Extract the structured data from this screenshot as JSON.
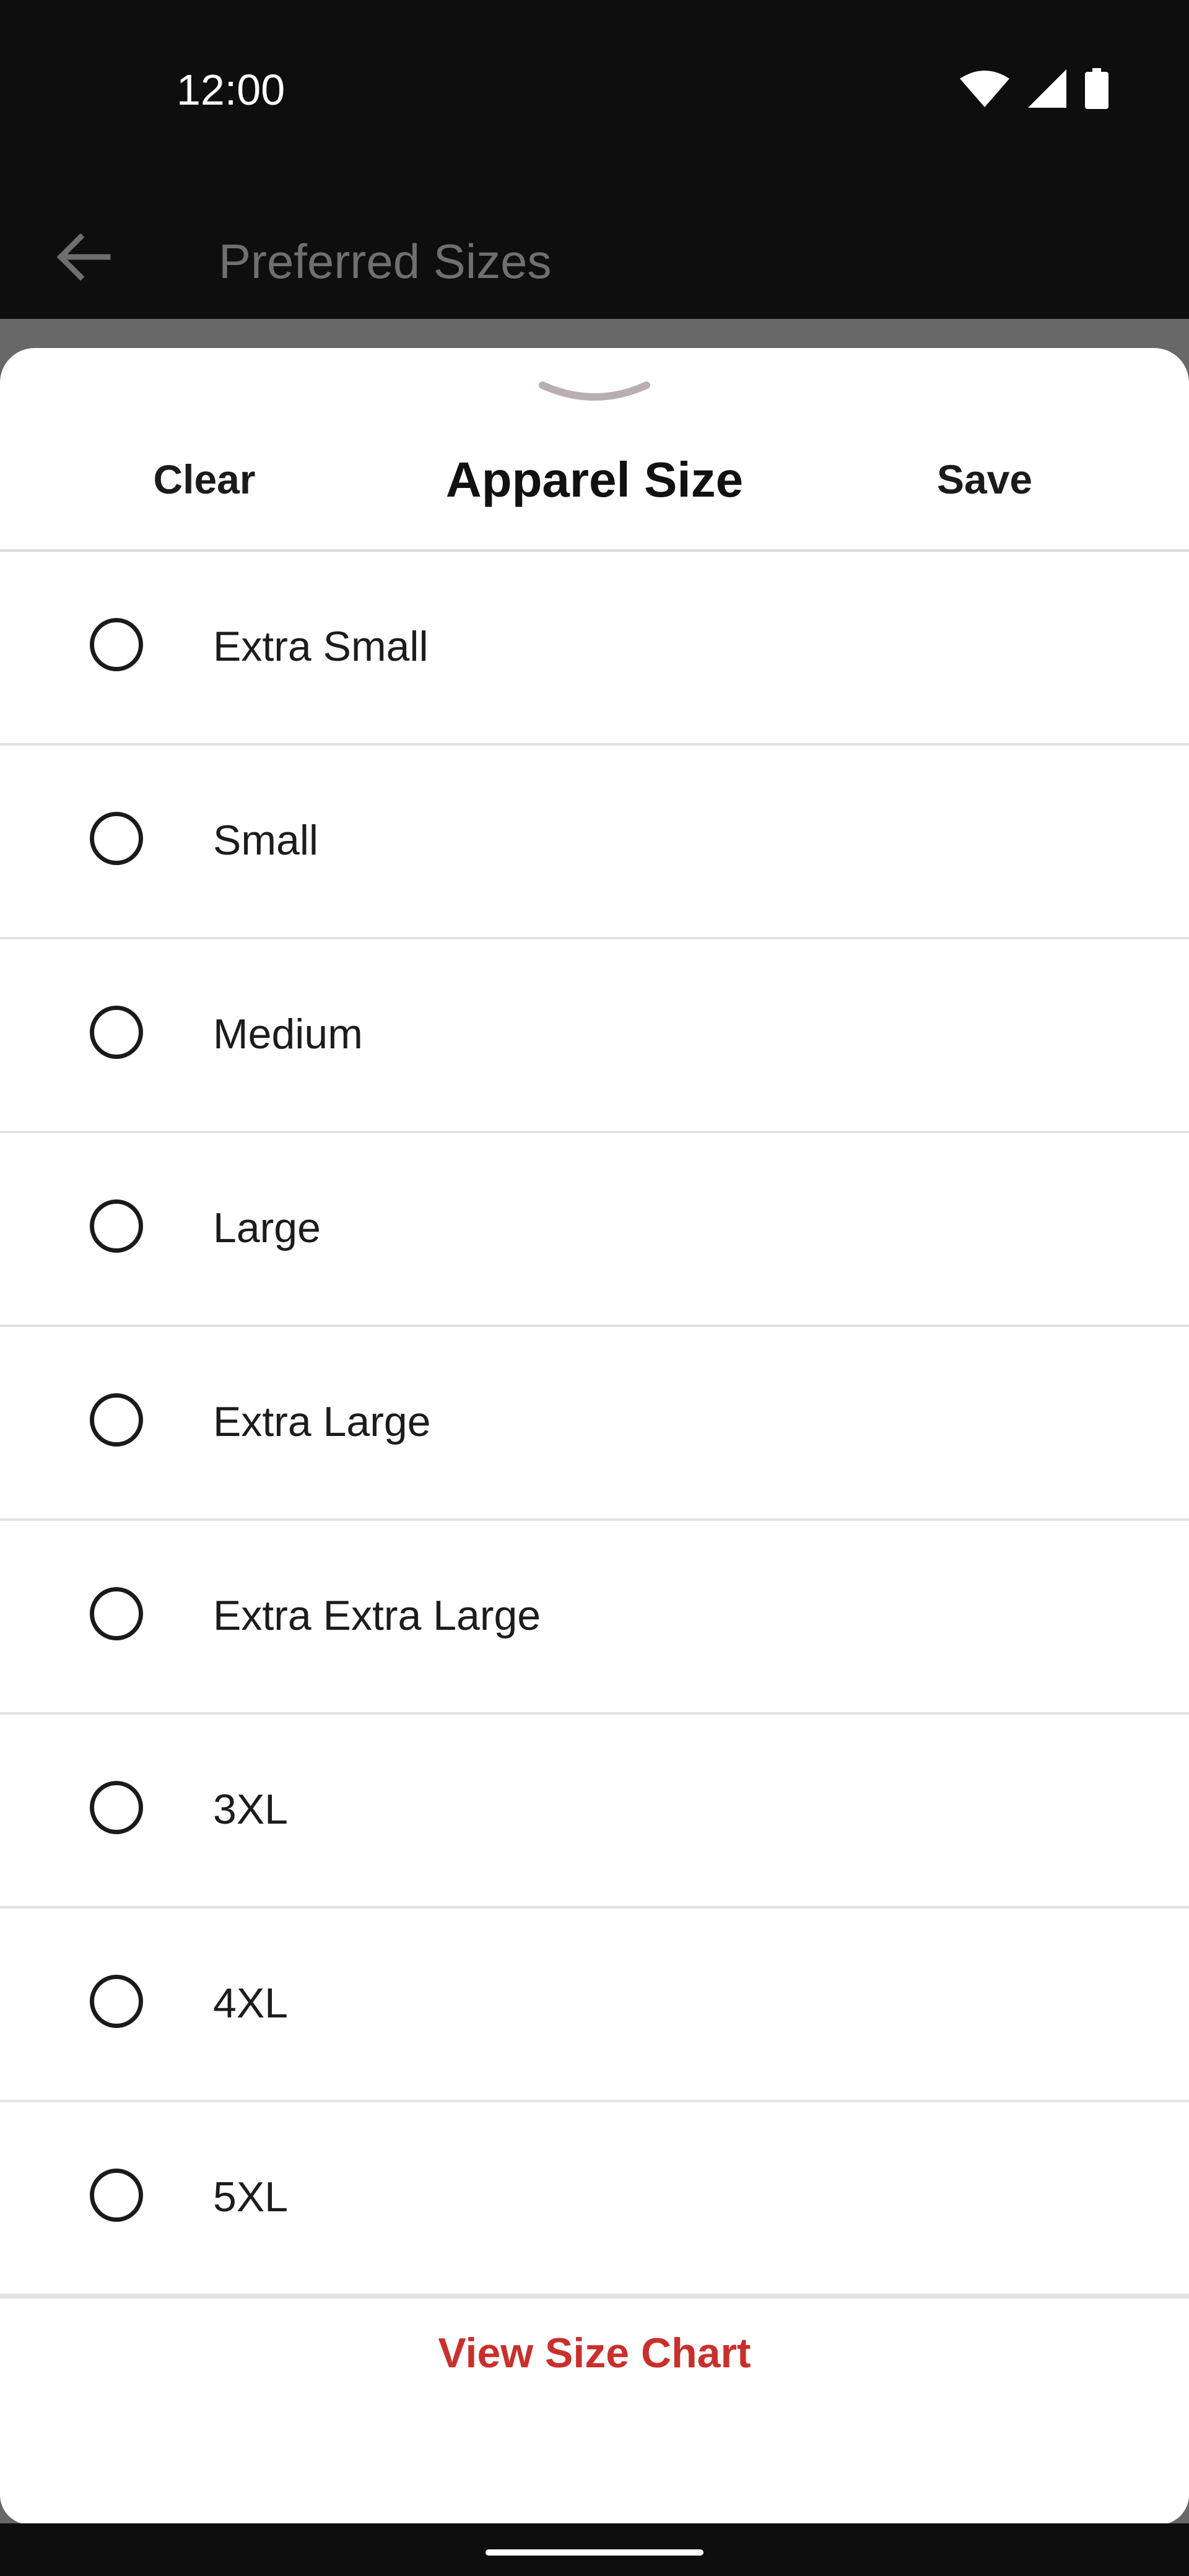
{
  "status_bar": {
    "time": "12:00",
    "icons": [
      "wifi-icon",
      "signal-icon",
      "battery-icon"
    ]
  },
  "toolbar": {
    "title": "Preferred Sizes",
    "back_icon": "back-arrow-icon"
  },
  "sheet": {
    "title": "Apparel Size",
    "clear_label": "Clear",
    "save_label": "Save",
    "options": [
      {
        "label": "Extra Small",
        "selected": false
      },
      {
        "label": "Small",
        "selected": false
      },
      {
        "label": "Medium",
        "selected": false
      },
      {
        "label": "Large",
        "selected": false
      },
      {
        "label": "Extra Large",
        "selected": false
      },
      {
        "label": "Extra Extra Large",
        "selected": false
      },
      {
        "label": "3XL",
        "selected": false
      },
      {
        "label": "4XL",
        "selected": false
      },
      {
        "label": "5XL",
        "selected": false
      }
    ],
    "size_chart_label": "View Size Chart"
  },
  "colors": {
    "accent": "#c9302c",
    "scrim": "#686868",
    "background_dark": "#0e0e0e",
    "handle": "#b9aeb2"
  }
}
